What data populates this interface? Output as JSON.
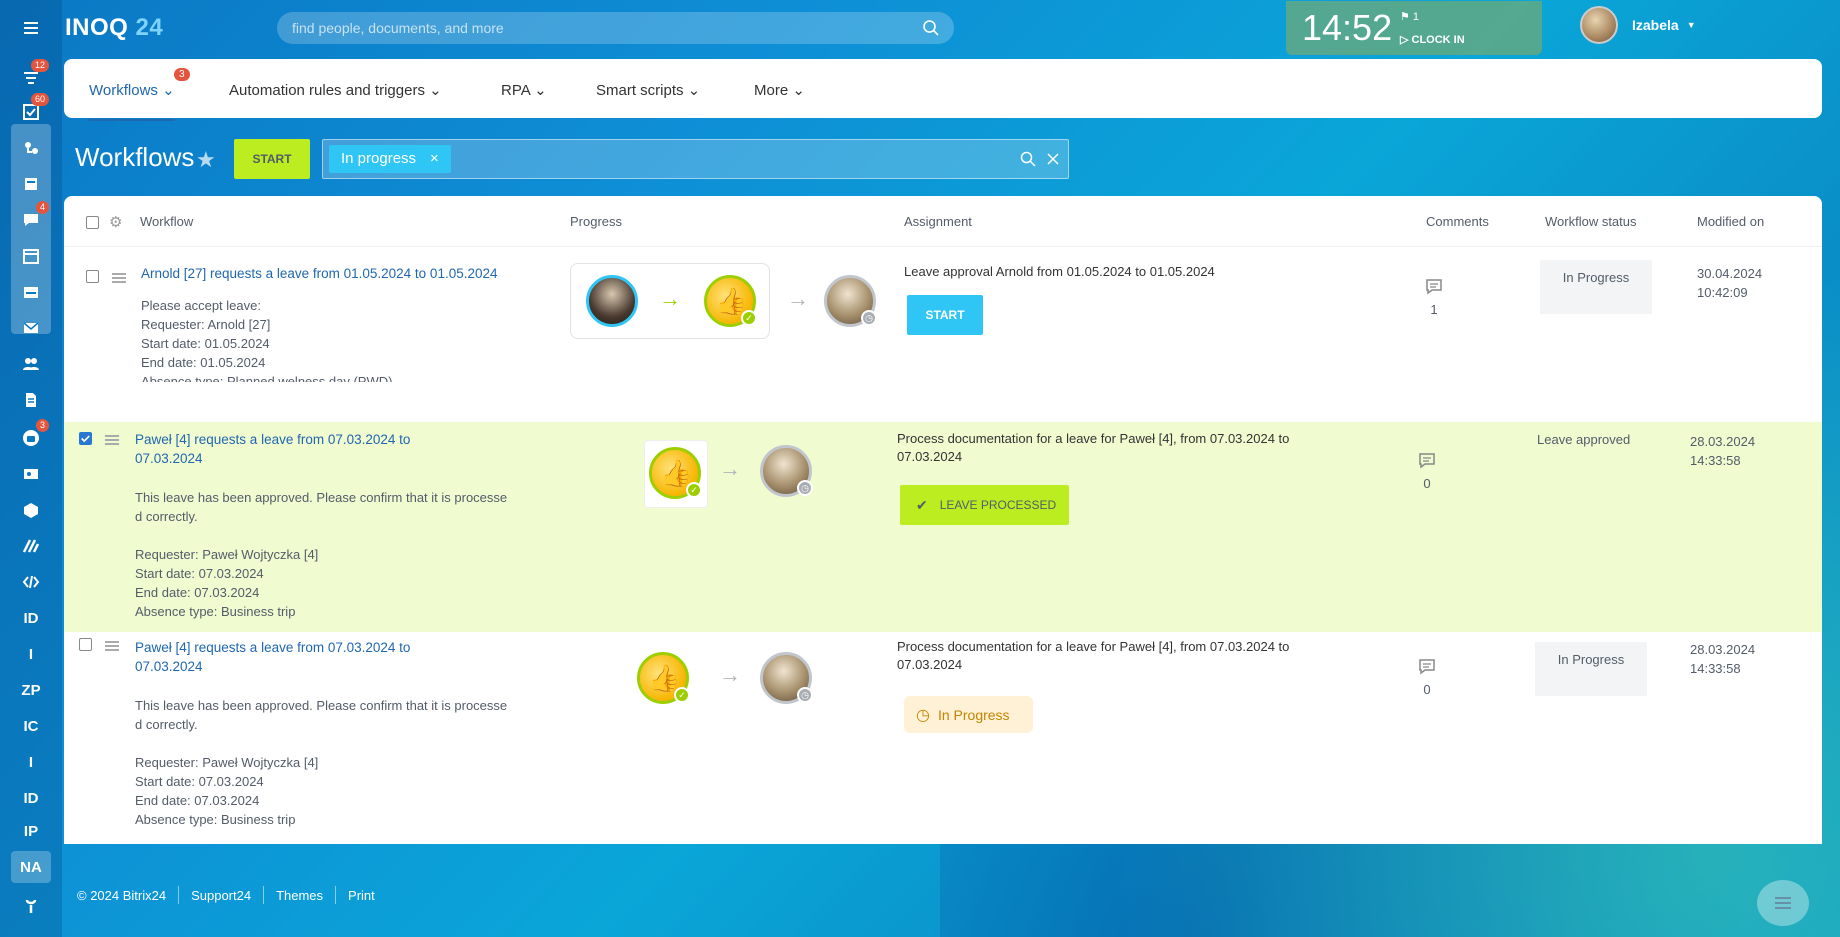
{
  "app": {
    "logo_text": "INOQ",
    "logo_num": "24"
  },
  "search": {
    "placeholder": "find people, documents, and more"
  },
  "clock": {
    "time": "14:52",
    "flag_count": "1",
    "clock_in": "CLOCK IN"
  },
  "user": {
    "name": "Izabela"
  },
  "leftbar": {
    "badges": {
      "feed": "12",
      "tasks": "60",
      "chat": "4",
      "robots": "3"
    },
    "text_items": [
      "ID",
      "I",
      "ZP",
      "IC",
      "I",
      "ID",
      "IP",
      "NA"
    ]
  },
  "topnav": {
    "items": [
      {
        "label": "Workflows",
        "badge": "3"
      },
      {
        "label": "Automation rules and triggers"
      },
      {
        "label": "RPA"
      },
      {
        "label": "Smart scripts"
      },
      {
        "label": "More"
      }
    ]
  },
  "page": {
    "title": "Workflows",
    "start_button": "START",
    "filter_tag": "In progress"
  },
  "table": {
    "headers": {
      "workflow": "Workflow",
      "progress": "Progress",
      "assignment": "Assignment",
      "comments": "Comments",
      "status": "Workflow status",
      "modified": "Modified on"
    },
    "rows": [
      {
        "title": "Arnold [27] requests a leave from 01.05.2024 to 01.05.2024",
        "desc": "Please accept leave:\nRequester: Arnold [27]\nStart date: 01.05.2024\nEnd date: 01.05.2024\nAbsence type: Planned welness day (PWD)",
        "assignment": "Leave approval  Arnold from 01.05.2024 to 01.05.2024",
        "action": "START",
        "comments": "1",
        "status": "In Progress",
        "modified": "30.04.2024\n10:42:09",
        "checked": false
      },
      {
        "title": "Paweł  [4] requests a leave from 07.03.2024 to 07.03.2024",
        "desc": "This leave has been approved. Please confirm that it is processe\nd correctly.\n\nRequester: Paweł Wojtyczka [4]\nStart date: 07.03.2024\nEnd date: 07.03.2024\nAbsence type: Business trip",
        "assignment": "Process documentation for a leave for Paweł [4], from 07.03.2024 to\n07.03.2024",
        "action": "LEAVE PROCESSED",
        "comments": "0",
        "status": "Leave approved",
        "modified": "28.03.2024\n14:33:58",
        "checked": true
      },
      {
        "title": "Paweł  [4] requests a leave from 07.03.2024 to 07.03.2024",
        "desc": "This leave has been approved. Please confirm that it is processe\nd correctly.\n\nRequester: Paweł Wojtyczka [4]\nStart date: 07.03.2024\nEnd date: 07.03.2024\nAbsence type: Business trip",
        "assignment": "Process documentation for a leave for Paweł [4], from 07.03.2024 to\n07.03.2024",
        "action": "In Progress",
        "comments": "0",
        "status": "In Progress",
        "modified": "28.03.2024\n14:33:58",
        "checked": false
      }
    ]
  },
  "footer": {
    "copyright": "© 2024 Bitrix24",
    "links": [
      "Support24",
      "Themes",
      "Print"
    ]
  },
  "colors": {
    "accent": "#2067b0",
    "start_green": "#bbed21",
    "start_blue": "#2fc6f6",
    "row_highlight": "#f1fbd0"
  }
}
